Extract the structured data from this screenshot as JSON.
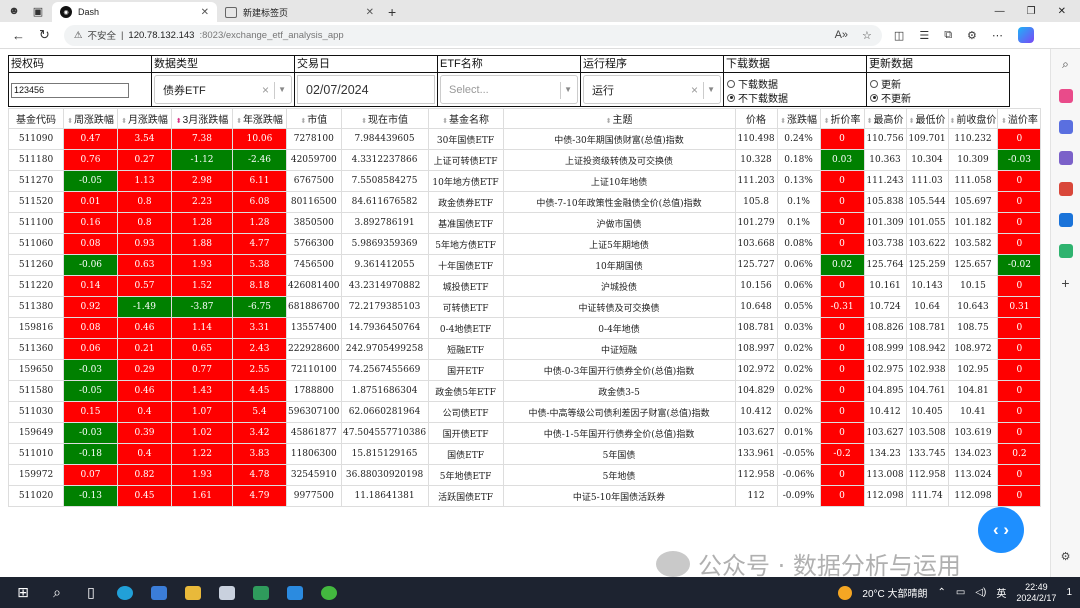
{
  "browser": {
    "tabs": [
      {
        "title": "Dash",
        "favicon": "dash-favicon"
      },
      {
        "title": "新建标签页",
        "favicon": "newtab-favicon"
      }
    ],
    "url_warning": "不安全",
    "url_host": "120.78.132.143",
    "url_path": ":8023/exchange_etf_analysis_app"
  },
  "filters": {
    "auth_label": "授权码",
    "auth_value": "123456",
    "datatype_label": "数据类型",
    "datatype_value": "债券ETF",
    "date_label": "交易日",
    "date_value": "02/07/2024",
    "etfname_label": "ETF名称",
    "etfname_placeholder": "Select...",
    "program_label": "运行程序",
    "program_value": "运行",
    "download_label": "下载数据",
    "download_opt1": "下载数据",
    "download_opt2": "不下载数据",
    "update_label": "更新数据",
    "update_opt1": "更新",
    "update_opt2": "不更新"
  },
  "table": {
    "headers": [
      "基金代码",
      "周涨跌幅",
      "月涨跌幅",
      "3月涨跌幅",
      "年涨跌幅",
      "市值",
      "现在市值",
      "基金名称",
      "主题",
      "价格",
      "涨跌幅",
      "折价率",
      "最高价",
      "最低价",
      "前收盘价",
      "溢价率"
    ],
    "rows": [
      [
        "511090",
        "0.47",
        "3.54",
        "7.38",
        "10.06",
        "7278100",
        "7.984439605",
        "30年国债ETF",
        "中债-30年期国债财富(总值)指数",
        "110.498",
        "0.24%",
        "0",
        "110.756",
        "109.701",
        "110.232",
        "0"
      ],
      [
        "511180",
        "0.76",
        "0.27",
        "-1.12",
        "-2.46",
        "42059700",
        "4.3312237866",
        "上证可转债ETF",
        "上证投资级转债及可交换债",
        "10.328",
        "0.18%",
        "0.03",
        "10.363",
        "10.304",
        "10.309",
        "-0.03"
      ],
      [
        "511270",
        "-0.05",
        "1.13",
        "2.98",
        "6.11",
        "6767500",
        "7.5508584275",
        "10年地方债ETF",
        "上证10年地债",
        "111.203",
        "0.13%",
        "0",
        "111.243",
        "111.03",
        "111.058",
        "0"
      ],
      [
        "511520",
        "0.01",
        "0.8",
        "2.23",
        "6.08",
        "80116500",
        "84.611676582",
        "政金债券ETF",
        "中债-7-10年政策性金融债全价(总值)指数",
        "105.8",
        "0.1%",
        "0",
        "105.838",
        "105.544",
        "105.697",
        "0"
      ],
      [
        "511100",
        "0.16",
        "0.8",
        "1.28",
        "1.28",
        "3850500",
        "3.892786191",
        "基准国债ETF",
        "沪做市国债",
        "101.279",
        "0.1%",
        "0",
        "101.309",
        "101.055",
        "101.182",
        "0"
      ],
      [
        "511060",
        "0.08",
        "0.93",
        "1.88",
        "4.77",
        "5766300",
        "5.9869359369",
        "5年地方债ETF",
        "上证5年期地债",
        "103.668",
        "0.08%",
        "0",
        "103.738",
        "103.622",
        "103.582",
        "0"
      ],
      [
        "511260",
        "-0.06",
        "0.63",
        "1.93",
        "5.38",
        "7456500",
        "9.361412055",
        "十年国债ETF",
        "10年期国债",
        "125.727",
        "0.06%",
        "0.02",
        "125.764",
        "125.259",
        "125.657",
        "-0.02"
      ],
      [
        "511220",
        "0.14",
        "0.57",
        "1.52",
        "8.18",
        "426081400",
        "43.2314970882",
        "城投债ETF",
        "沪城投债",
        "10.156",
        "0.06%",
        "0",
        "10.161",
        "10.143",
        "10.15",
        "0"
      ],
      [
        "511380",
        "0.92",
        "-1.49",
        "-3.87",
        "-6.75",
        "681886700",
        "72.2179385103",
        "可转债ETF",
        "中证转债及可交换债",
        "10.648",
        "0.05%",
        "-0.31",
        "10.724",
        "10.64",
        "10.643",
        "0.31"
      ],
      [
        "159816",
        "0.08",
        "0.46",
        "1.14",
        "3.31",
        "13557400",
        "14.7936450764",
        "0-4地债ETF",
        "0-4年地债",
        "108.781",
        "0.03%",
        "0",
        "108.826",
        "108.781",
        "108.75",
        "0"
      ],
      [
        "511360",
        "0.06",
        "0.21",
        "0.65",
        "2.43",
        "222928600",
        "242.9705499258",
        "短融ETF",
        "中证短融",
        "108.997",
        "0.02%",
        "0",
        "108.999",
        "108.942",
        "108.972",
        "0"
      ],
      [
        "159650",
        "-0.03",
        "0.29",
        "0.77",
        "2.55",
        "72110100",
        "74.2567455669",
        "国开ETF",
        "中债-0-3年国开行债券全价(总值)指数",
        "102.972",
        "0.02%",
        "0",
        "102.975",
        "102.938",
        "102.95",
        "0"
      ],
      [
        "511580",
        "-0.05",
        "0.46",
        "1.43",
        "4.45",
        "1788800",
        "1.8751686304",
        "政金债5年ETF",
        "政金债3-5",
        "104.829",
        "0.02%",
        "0",
        "104.895",
        "104.761",
        "104.81",
        "0"
      ],
      [
        "511030",
        "0.15",
        "0.4",
        "1.07",
        "5.4",
        "596307100",
        "62.0660281964",
        "公司债ETF",
        "中债-中高等级公司债利差因子财富(总值)指数",
        "10.412",
        "0.02%",
        "0",
        "10.412",
        "10.405",
        "10.41",
        "0"
      ],
      [
        "159649",
        "-0.03",
        "0.39",
        "1.02",
        "3.42",
        "45861877",
        "47.504557710386",
        "国开债ETF",
        "中债-1-5年国开行债券全价(总值)指数",
        "103.627",
        "0.01%",
        "0",
        "103.627",
        "103.508",
        "103.619",
        "0"
      ],
      [
        "511010",
        "-0.18",
        "0.4",
        "1.22",
        "3.83",
        "11806300",
        "15.815129165",
        "国债ETF",
        "5年国债",
        "133.961",
        "-0.05%",
        "-0.2",
        "134.23",
        "133.745",
        "134.023",
        "0.2"
      ],
      [
        "159972",
        "0.07",
        "0.82",
        "1.93",
        "4.78",
        "32545910",
        "36.88030920198",
        "5年地债ETF",
        "5年地债",
        "112.958",
        "-0.06%",
        "0",
        "113.008",
        "112.958",
        "113.024",
        "0"
      ],
      [
        "511020",
        "-0.13",
        "0.45",
        "1.61",
        "4.79",
        "9977500",
        "11.18641381",
        "活跃国债ETF",
        "中证5-10年国债活跃券",
        "112",
        "-0.09%",
        "0",
        "112.098",
        "111.74",
        "112.098",
        "0"
      ]
    ]
  },
  "watermark": "公众号 · 数据分析与运用",
  "taskbar": {
    "weather": "20°C 大部晴朗",
    "ime": "英",
    "time": "22:49",
    "date": "2024/2/17",
    "notify": "1"
  },
  "colors": {
    "positive": "#ff0000",
    "negative": "#008000",
    "fab": "#1e8fff"
  }
}
